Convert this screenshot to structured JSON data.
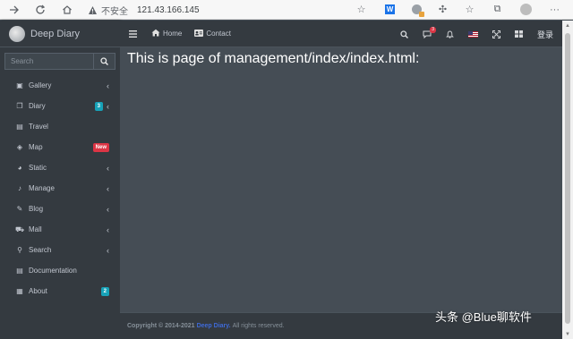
{
  "browser": {
    "back_icon": "arrow-right-icon",
    "url_warning": "不安全",
    "url": "121.43.166.145"
  },
  "sidebar": {
    "brand": "Deep Diary",
    "search_placeholder": "Search",
    "items": [
      {
        "label": "Gallery",
        "icon": "image-icon",
        "glyph": "▣",
        "chevron": true
      },
      {
        "label": "Diary",
        "icon": "copy-icon",
        "glyph": "❐",
        "badge": "3",
        "badge_color": "#17a2b8",
        "chevron": true
      },
      {
        "label": "Travel",
        "icon": "file-icon",
        "glyph": "▤"
      },
      {
        "label": "Map",
        "icon": "map-icon",
        "glyph": "◈",
        "badge": "New",
        "badge_color": "#dc3545"
      },
      {
        "label": "Static",
        "icon": "pie-chart-icon",
        "glyph": "◕",
        "chevron": true
      },
      {
        "label": "Manage",
        "icon": "bell-icon",
        "glyph": "♪",
        "chevron": true
      },
      {
        "label": "Blog",
        "icon": "edit-icon",
        "glyph": "✎",
        "chevron": true
      },
      {
        "label": "Mall",
        "icon": "cart-icon",
        "glyph": "⛟",
        "chevron": true
      },
      {
        "label": "Search",
        "icon": "search-icon",
        "glyph": "⚲",
        "chevron": true
      },
      {
        "label": "Documentation",
        "icon": "document-icon",
        "glyph": "▤"
      },
      {
        "label": "About",
        "icon": "calendar-icon",
        "glyph": "▦",
        "badge": "2",
        "badge_color": "#17a2b8"
      }
    ]
  },
  "topbar": {
    "home": "Home",
    "contact": "Contact",
    "notification_count": "3",
    "login": "登录"
  },
  "content": {
    "heading": "This is page of management/index/index.html:"
  },
  "footer": {
    "prefix": "Copyright © 2014-2021",
    "brand": "Deep Diary.",
    "suffix": "All rights reserved."
  },
  "watermark": "头条 @Blue聊软件",
  "colors": {
    "sidebar_bg": "#343a40",
    "content_bg": "#454d55",
    "badge_info": "#17a2b8",
    "badge_danger": "#dc3545",
    "brand_link": "#3f6ad8"
  }
}
